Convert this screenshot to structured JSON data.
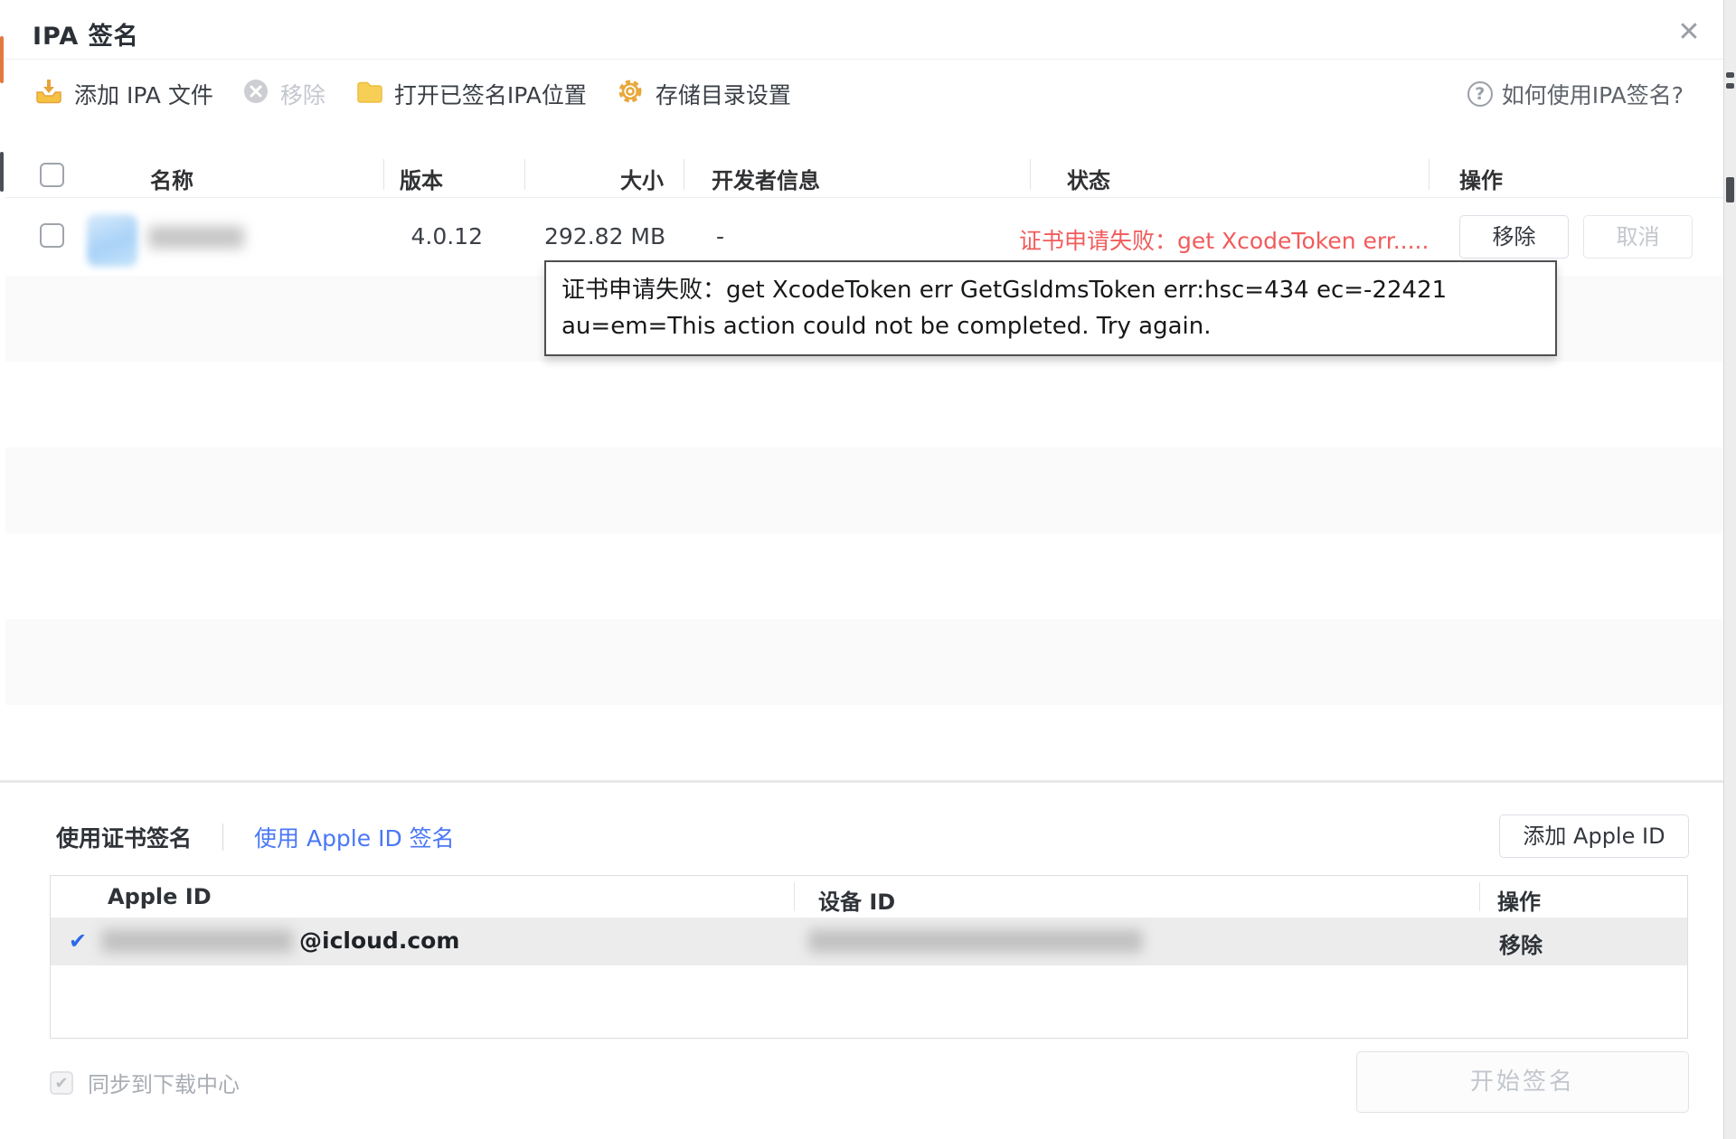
{
  "window": {
    "title": "IPA 签名",
    "close_glyph": "✕"
  },
  "toolbar": {
    "add_ipa_label": "添加 IPA 文件",
    "remove_label": "移除",
    "open_location_label": "打开已签名IPA位置",
    "storage_settings_label": "存储目录设置",
    "help_label": "如何使用IPA签名?",
    "help_glyph": "?"
  },
  "ipa_table": {
    "columns": [
      "名称",
      "版本",
      "大小",
      "开发者信息",
      "状态",
      "操作"
    ],
    "row": {
      "version": "4.0.12",
      "size": "292.82 MB",
      "developer": "-",
      "status": "证书申请失败：get XcodeToken err.....",
      "remove_label": "移除",
      "cancel_label": "取消"
    }
  },
  "tooltip": {
    "text": "证书申请失败：get XcodeToken err GetGsldmsToken err:hsc=434 ec=-22421 au=em=This action could not be completed. Try again."
  },
  "sign_panel": {
    "tab_cert_label": "使用证书签名",
    "tab_appleid_label": "使用 Apple ID 签名",
    "add_appleid_label": "添加 Apple ID",
    "table": {
      "columns": [
        "Apple ID",
        "设备 ID",
        "操作"
      ],
      "row": {
        "check_glyph": "✔",
        "appleid_visible": "@icloud.com",
        "remove_label": "移除"
      }
    },
    "sync_label": "同步到下载中心",
    "sync_check_glyph": "✔",
    "start_label": "开始签名"
  },
  "colors": {
    "accent_blue": "#4a77f6",
    "error_red": "#f25b5b",
    "icon_yellow": "#f5c242",
    "icon_orange": "#e8a23d"
  }
}
